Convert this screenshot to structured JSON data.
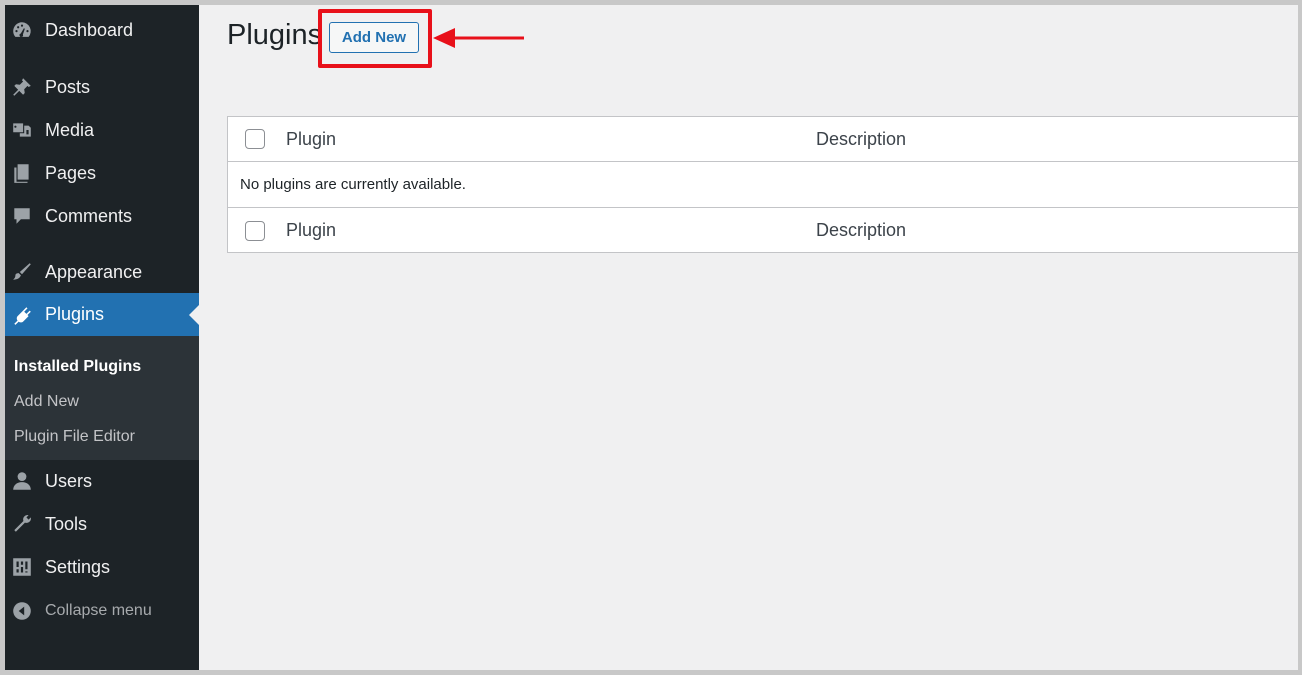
{
  "sidebar": {
    "items": [
      {
        "label": "Dashboard",
        "icon": "dashboard-icon"
      },
      {
        "label": "Posts",
        "icon": "pin-icon"
      },
      {
        "label": "Media",
        "icon": "media-icon"
      },
      {
        "label": "Pages",
        "icon": "pages-icon"
      },
      {
        "label": "Comments",
        "icon": "comment-icon"
      },
      {
        "label": "Appearance",
        "icon": "paintbrush-icon"
      },
      {
        "label": "Plugins",
        "icon": "plugin-icon",
        "active": true
      },
      {
        "label": "Users",
        "icon": "user-icon"
      },
      {
        "label": "Tools",
        "icon": "wrench-icon"
      },
      {
        "label": "Settings",
        "icon": "settings-icon"
      }
    ],
    "submenu": [
      {
        "label": "Installed Plugins",
        "current": true
      },
      {
        "label": "Add New"
      },
      {
        "label": "Plugin File Editor"
      }
    ],
    "collapse_label": "Collapse menu"
  },
  "main": {
    "title": "Plugins",
    "add_new_label": "Add New",
    "table": {
      "columns": [
        "Plugin",
        "Description"
      ],
      "empty_message": "No plugins are currently available."
    }
  },
  "colors": {
    "sidebar_bg": "#1d2327",
    "active_bg": "#2271b1",
    "highlight": "#e8101a",
    "content_bg": "#f0f0f1"
  }
}
